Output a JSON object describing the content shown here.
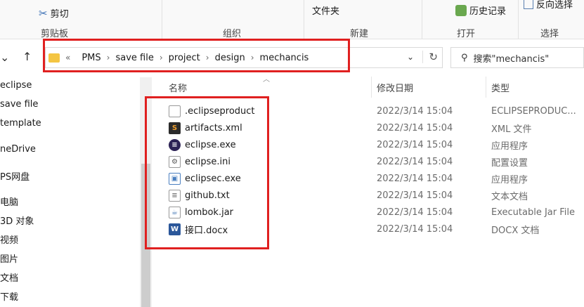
{
  "ribbon": {
    "cut_label": "剪切",
    "file_folder_partial": "文件夹",
    "history_label": "历史记录",
    "reverse_select_label": "反向选择",
    "groups": [
      "剪贴板",
      "组织",
      "新建",
      "打开",
      "选择"
    ]
  },
  "address": {
    "crumbs": [
      "PMS",
      "save file",
      "project",
      "design",
      "mechancis"
    ],
    "search_placeholder": "搜索\"mechancis\""
  },
  "sidebar": {
    "items": [
      "eclipse",
      "save file",
      "template",
      "neDrive",
      "PS网盘",
      "电脑",
      "3D 对象",
      "视频",
      "图片",
      "文档",
      "下载"
    ]
  },
  "columns": {
    "name": "名称",
    "modified": "修改日期",
    "type": "类型"
  },
  "files": [
    {
      "name": ".eclipseproduct",
      "date": "2022/3/14 15:04",
      "type": "ECLIPSEPRODUC...",
      "icon": "generic-file-icon"
    },
    {
      "name": "artifacts.xml",
      "date": "2022/3/14 15:04",
      "type": "XML 文件",
      "icon": "xml-icon"
    },
    {
      "name": "eclipse.exe",
      "date": "2022/3/14 15:04",
      "type": "应用程序",
      "icon": "eclipse-icon"
    },
    {
      "name": "eclipse.ini",
      "date": "2022/3/14 15:04",
      "type": "配置设置",
      "icon": "ini-file-icon"
    },
    {
      "name": "eclipsec.exe",
      "date": "2022/3/14 15:04",
      "type": "应用程序",
      "icon": "console-app-icon"
    },
    {
      "name": "github.txt",
      "date": "2022/3/14 15:04",
      "type": "文本文档",
      "icon": "text-file-icon"
    },
    {
      "name": "lombok.jar",
      "date": "2022/3/14 15:04",
      "type": "Executable Jar File",
      "icon": "jar-icon"
    },
    {
      "name": "接口.docx",
      "date": "2022/3/14 15:04",
      "type": "DOCX 文档",
      "icon": "word-doc-icon"
    }
  ],
  "colors": {
    "highlight": "#e02020",
    "folder": "#f4c542"
  }
}
